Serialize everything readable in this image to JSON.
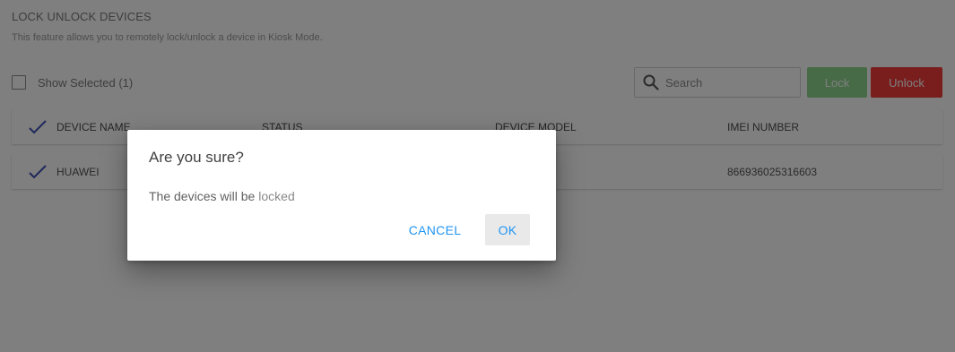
{
  "header": {
    "title": "LOCK UNLOCK DEVICES",
    "subtitle": "This feature allows you to remotely lock/unlock a device in Kiosk Mode."
  },
  "toolbar": {
    "show_selected_label": "Show Selected (1)",
    "search_placeholder": "Search",
    "lock_label": "Lock",
    "unlock_label": "Unlock"
  },
  "table": {
    "columns": [
      "DEVICE NAME",
      "STATUS",
      "DEVICE MODEL",
      "IMEI NUMBER"
    ],
    "rows": [
      {
        "device_name": "HUAWEI",
        "status": "",
        "device_model": "",
        "imei": "866936025316603",
        "selected": true
      }
    ]
  },
  "dialog": {
    "title": "Are you sure?",
    "message": "The devices will be",
    "mode": "locked",
    "cancel_label": "CANCEL",
    "ok_label": "OK"
  },
  "colors": {
    "lock_button": "#8fd68e",
    "unlock_button": "#f23b3b",
    "accent": "#2196f3",
    "check": "#3f51b5"
  }
}
